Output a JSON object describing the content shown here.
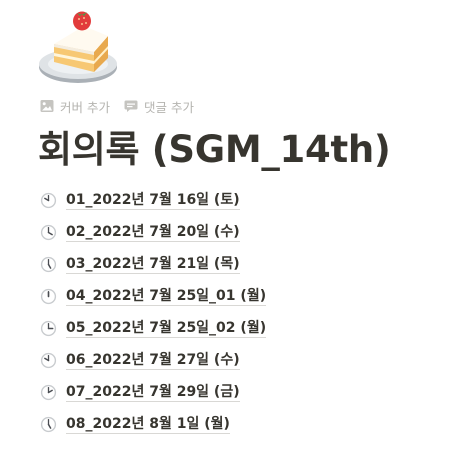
{
  "page_icon": "shortcake-icon",
  "controls": {
    "add_cover": "커버 추가",
    "add_comment": "댓글 추가"
  },
  "title": "회의록 (SGM_14th)",
  "pages": [
    {
      "label": "01_2022년 7월 16일 (토)",
      "icon": "clock-icon",
      "hour": 10
    },
    {
      "label": "02_2022년 7월 20일 (수)",
      "icon": "clock-icon",
      "hour": 4
    },
    {
      "label": "03_2022년 7월 21일 (목)",
      "icon": "clock-icon",
      "hour": 5
    },
    {
      "label": "04_2022년 7월 25일_01 (월)",
      "icon": "clock-icon",
      "hour": 12
    },
    {
      "label": "05_2022년 7월 25일_02 (월)",
      "icon": "clock-icon",
      "hour": 3
    },
    {
      "label": "06_2022년 7월 27일 (수)",
      "icon": "clock-icon",
      "hour": 10
    },
    {
      "label": "07_2022년 7월 29일 (금)",
      "icon": "clock-icon",
      "hour": 2
    },
    {
      "label": "08_2022년 8월 1일 (월)",
      "icon": "clock-icon",
      "hour": 5
    }
  ]
}
